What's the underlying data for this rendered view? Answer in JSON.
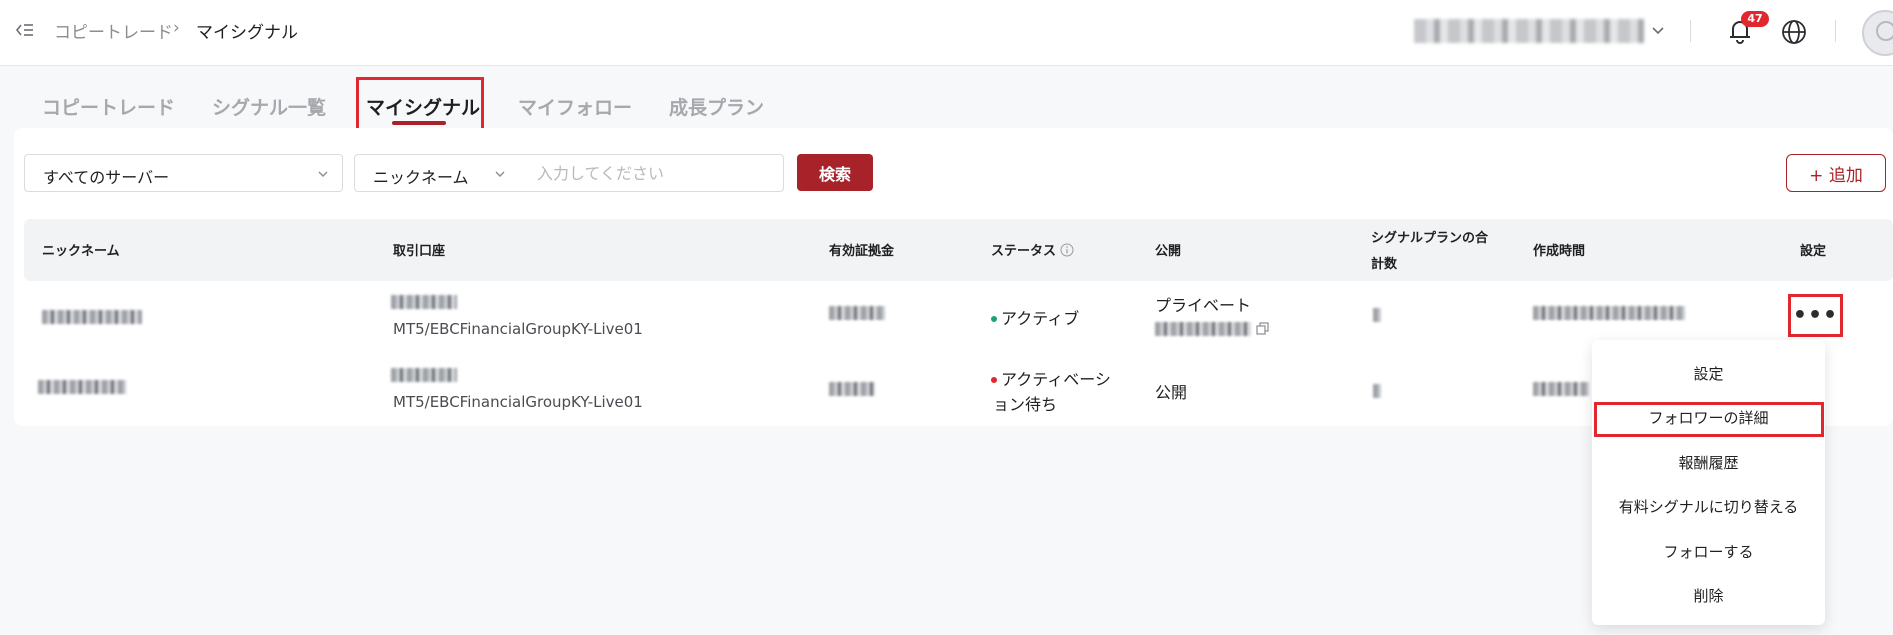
{
  "breadcrumb": {
    "parent": "コピートレード",
    "separator": "›",
    "current": "マイシグナル"
  },
  "header": {
    "notification_count": "47"
  },
  "tabs": [
    {
      "label": "コピートレード"
    },
    {
      "label": "シグナル一覧"
    },
    {
      "label": "マイシグナル",
      "active": true
    },
    {
      "label": "マイフォロー"
    },
    {
      "label": "成長プラン"
    }
  ],
  "filters": {
    "server_select": "すべてのサーバー",
    "field_select": "ニックネーム",
    "search_placeholder": "入力してください",
    "search_button": "検索",
    "add_button": "+ 追加"
  },
  "table": {
    "columns": [
      "ニックネーム",
      "取引口座",
      "有効証拠金",
      "ステータス",
      "公開",
      "シグナルプランの合",
      "計数",
      "作成時間",
      "設定"
    ],
    "rows": [
      {
        "account_server": "MT5/EBCFinancialGroupKY-Live01",
        "status": "アクティブ",
        "status_color": "#1aa37a",
        "visibility": "プライベート"
      },
      {
        "account_server": "MT5/EBCFinancialGroupKY-Live01",
        "status_line1": "アクティベーシ",
        "status_line2": "ョン待ち",
        "status_color": "#e0282e",
        "visibility": "公開"
      }
    ],
    "more_button": "•••"
  },
  "menu": {
    "items": [
      "設定",
      "フォロワーの詳細",
      "報酬履歴",
      "有料シグナルに切り替える",
      "フォローする",
      "削除"
    ]
  },
  "colors": {
    "brand": "#a8222a",
    "highlight": "#e0282e"
  }
}
